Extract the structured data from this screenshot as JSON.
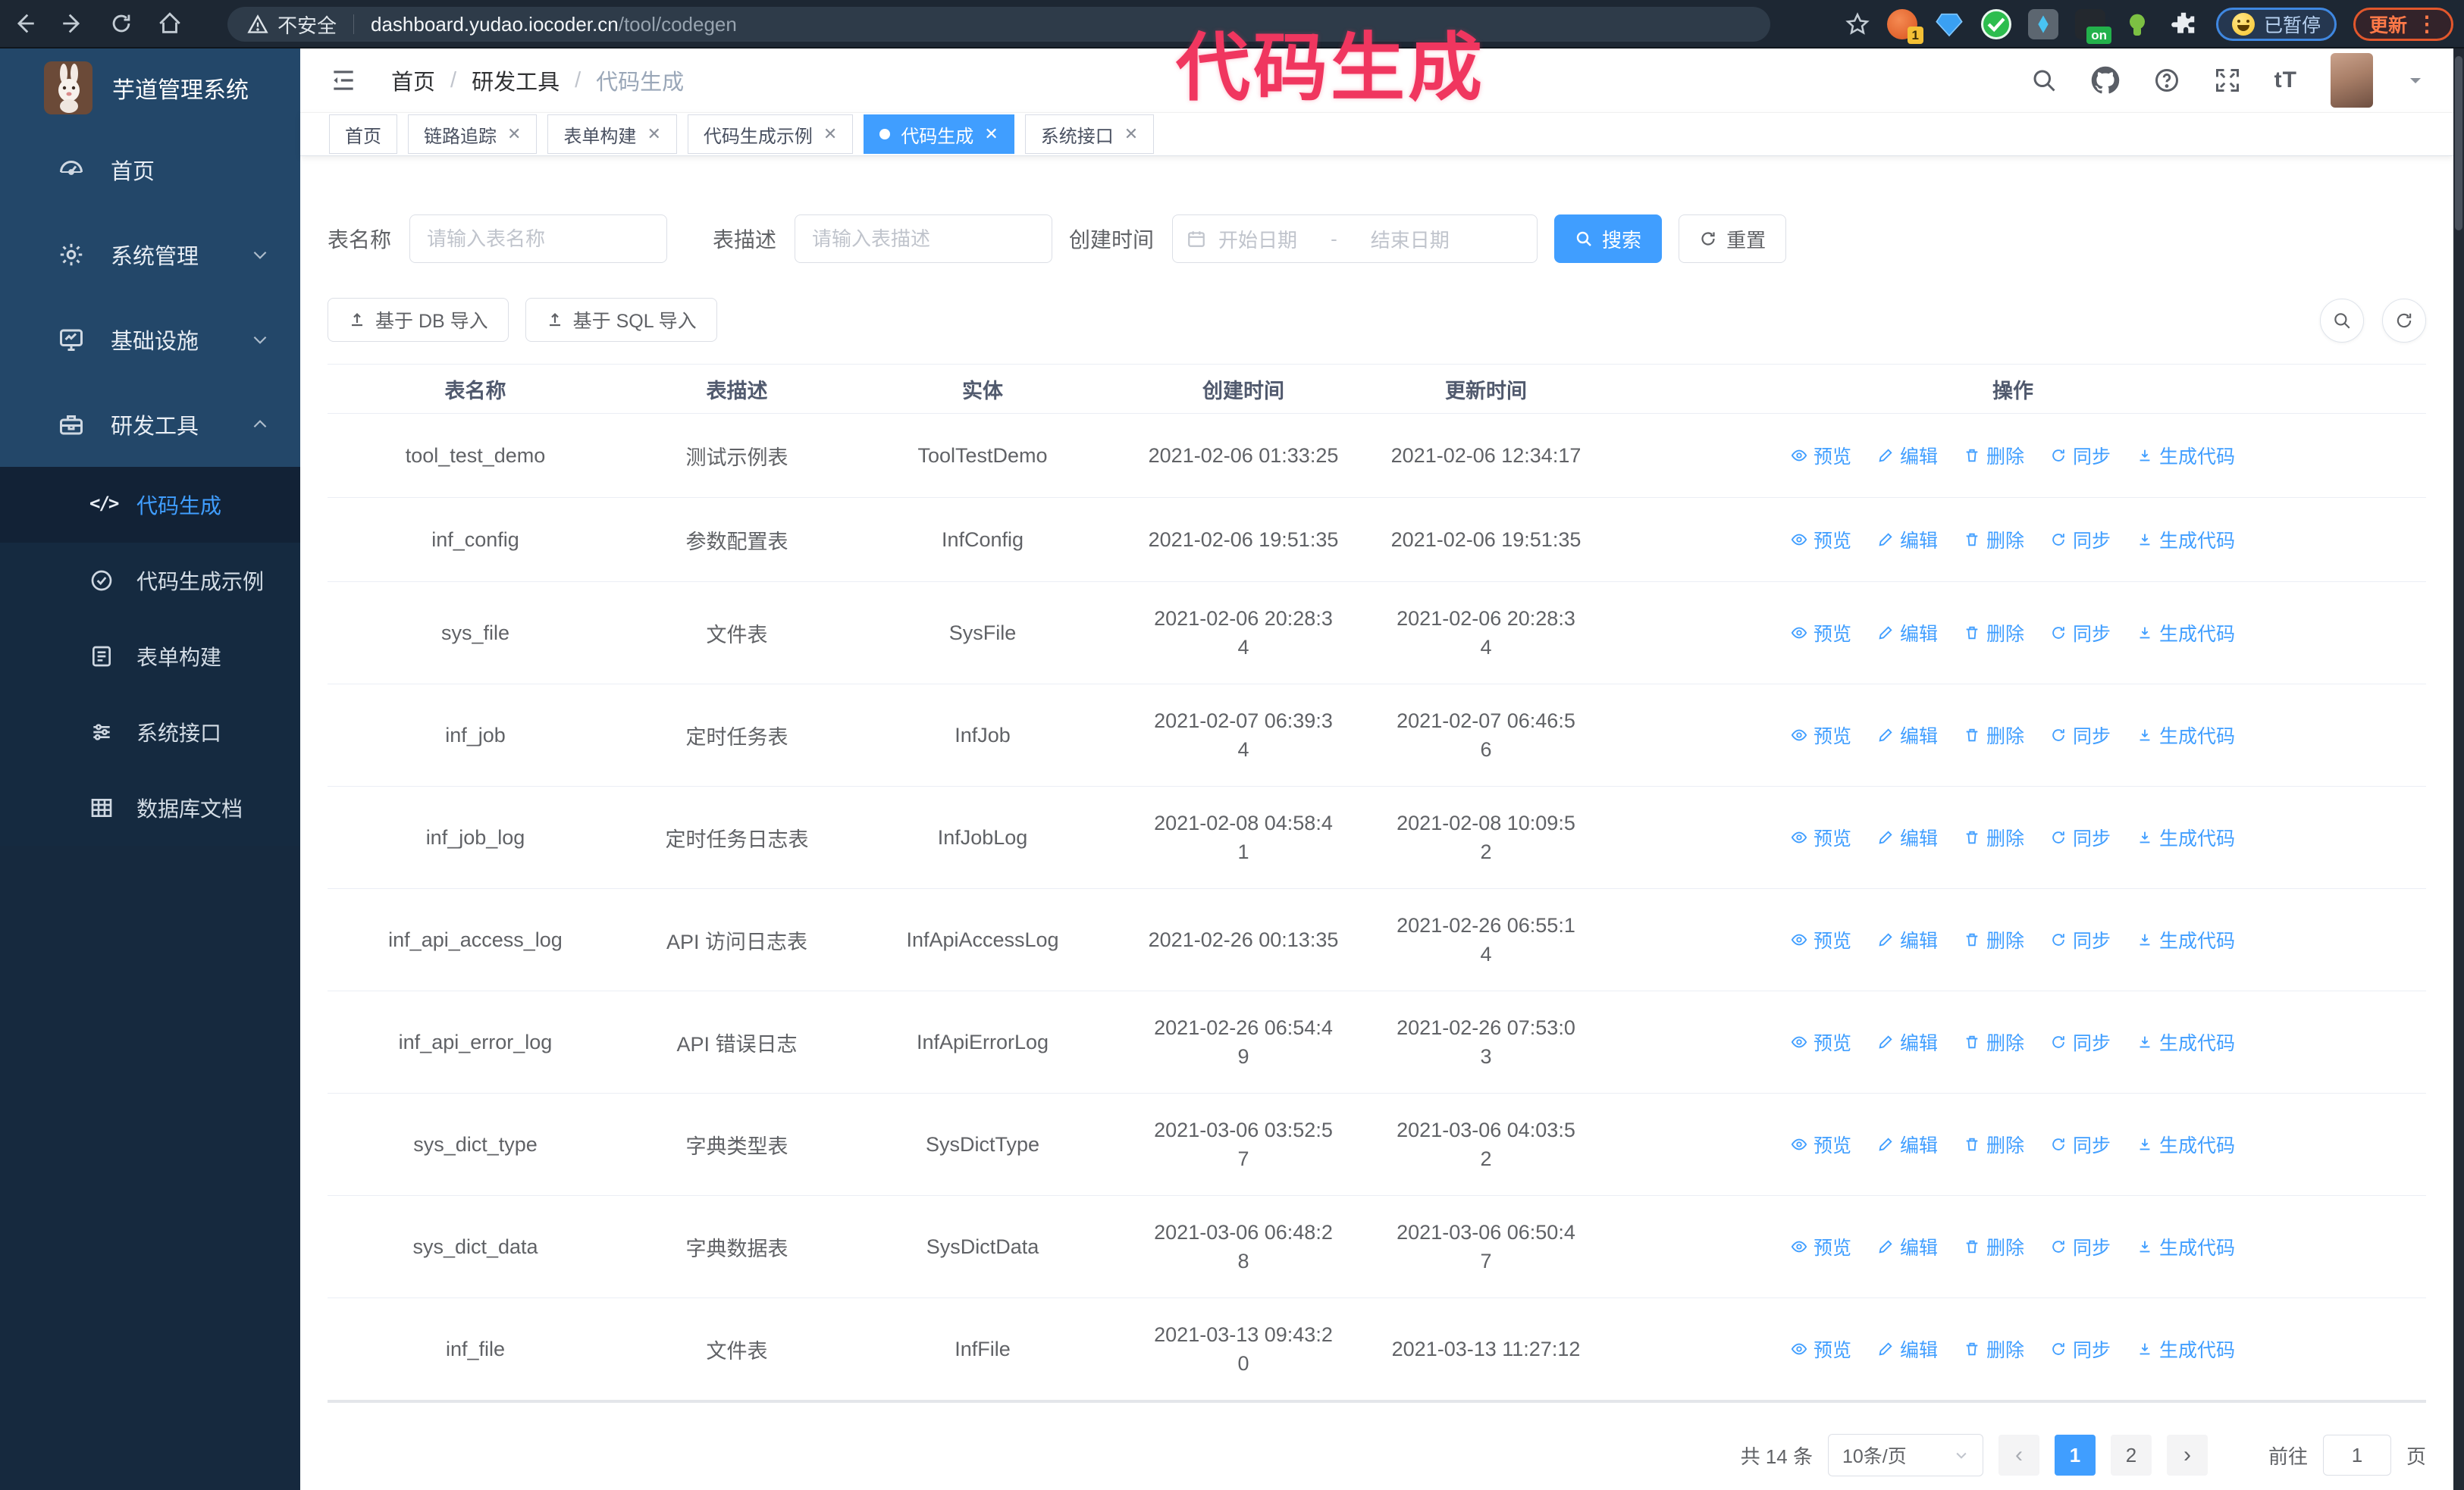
{
  "annotation": {
    "text": "代码生成",
    "color": "#f0365f"
  },
  "browser": {
    "security_label": "不安全",
    "url_host": "dashboard.yudao.iocoder.cn",
    "url_path": "/tool/codegen",
    "extension_badge": "1",
    "extension_on_badge": "on",
    "paused_badge": "已暂停",
    "update_button": "更新"
  },
  "sidebar": {
    "app_title": "芋道管理系统",
    "items": [
      {
        "label": "首页",
        "icon": "dashboard-icon"
      },
      {
        "label": "系统管理",
        "icon": "gear-icon"
      },
      {
        "label": "基础设施",
        "icon": "monitor-icon"
      },
      {
        "label": "研发工具",
        "icon": "toolbox-icon"
      }
    ],
    "submenu": [
      {
        "label": "代码生成",
        "icon": "code-icon",
        "active": true
      },
      {
        "label": "代码生成示例",
        "icon": "check-circle-icon"
      },
      {
        "label": "表单构建",
        "icon": "form-icon"
      },
      {
        "label": "系统接口",
        "icon": "api-icon"
      },
      {
        "label": "数据库文档",
        "icon": "database-doc-icon"
      }
    ]
  },
  "header": {
    "breadcrumb": [
      "首页",
      "研发工具",
      "代码生成"
    ],
    "code_glyph": "</>"
  },
  "tabs": [
    {
      "label": "首页",
      "closable": false,
      "active": false
    },
    {
      "label": "链路追踪",
      "closable": true,
      "active": false
    },
    {
      "label": "表单构建",
      "closable": true,
      "active": false
    },
    {
      "label": "代码生成示例",
      "closable": true,
      "active": false
    },
    {
      "label": "代码生成",
      "closable": true,
      "active": true
    },
    {
      "label": "系统接口",
      "closable": true,
      "active": false
    }
  ],
  "filters": {
    "name_label": "表名称",
    "name_placeholder": "请输入表名称",
    "desc_label": "表描述",
    "desc_placeholder": "请输入表描述",
    "time_label": "创建时间",
    "start_placeholder": "开始日期",
    "range_separator": "-",
    "end_placeholder": "结束日期",
    "search_label": "搜索",
    "reset_label": "重置"
  },
  "toolbar": {
    "import_db_label": "基于 DB 导入",
    "import_sql_label": "基于 SQL 导入"
  },
  "table": {
    "columns": [
      "表名称",
      "表描述",
      "实体",
      "创建时间",
      "更新时间",
      "操作"
    ],
    "rows": [
      {
        "name": "tool_test_demo",
        "desc": "测试示例表",
        "entity": "ToolTestDemo",
        "created": "2021-02-06 01:33:25",
        "updated": "2021-02-06 12:34:17"
      },
      {
        "name": "inf_config",
        "desc": "参数配置表",
        "entity": "InfConfig",
        "created": "2021-02-06 19:51:35",
        "updated": "2021-02-06 19:51:35"
      },
      {
        "name": "sys_file",
        "desc": "文件表",
        "entity": "SysFile",
        "created": "2021-02-06 20:28:3\n4",
        "updated": "2021-02-06 20:28:3\n4"
      },
      {
        "name": "inf_job",
        "desc": "定时任务表",
        "entity": "InfJob",
        "created": "2021-02-07 06:39:3\n4",
        "updated": "2021-02-07 06:46:5\n6"
      },
      {
        "name": "inf_job_log",
        "desc": "定时任务日志表",
        "entity": "InfJobLog",
        "created": "2021-02-08 04:58:4\n1",
        "updated": "2021-02-08 10:09:5\n2"
      },
      {
        "name": "inf_api_access_log",
        "desc": "API 访问日志表",
        "entity": "InfApiAccessLog",
        "created": "2021-02-26 00:13:35",
        "updated": "2021-02-26 06:55:1\n4"
      },
      {
        "name": "inf_api_error_log",
        "desc": "API 错误日志",
        "entity": "InfApiErrorLog",
        "created": "2021-02-26 06:54:4\n9",
        "updated": "2021-02-26 07:53:0\n3"
      },
      {
        "name": "sys_dict_type",
        "desc": "字典类型表",
        "entity": "SysDictType",
        "created": "2021-03-06 03:52:5\n7",
        "updated": "2021-03-06 04:03:5\n2"
      },
      {
        "name": "sys_dict_data",
        "desc": "字典数据表",
        "entity": "SysDictData",
        "created": "2021-03-06 06:48:2\n8",
        "updated": "2021-03-06 06:50:4\n7"
      },
      {
        "name": "inf_file",
        "desc": "文件表",
        "entity": "InfFile",
        "created": "2021-03-13 09:43:2\n0",
        "updated": "2021-03-13 11:27:12"
      }
    ]
  },
  "row_actions": [
    {
      "label": "预览",
      "icon": "eye-icon"
    },
    {
      "label": "编辑",
      "icon": "edit-icon"
    },
    {
      "label": "删除",
      "icon": "delete-icon"
    },
    {
      "label": "同步",
      "icon": "sync-icon"
    },
    {
      "label": "生成代码",
      "icon": "download-icon"
    }
  ],
  "pagination": {
    "total_text": "共 14 条",
    "page_size": "10条/页",
    "pages": [
      "1",
      "2"
    ],
    "current_page": "1",
    "goto_label": "前往",
    "goto_value": "1",
    "goto_suffix": "页"
  }
}
